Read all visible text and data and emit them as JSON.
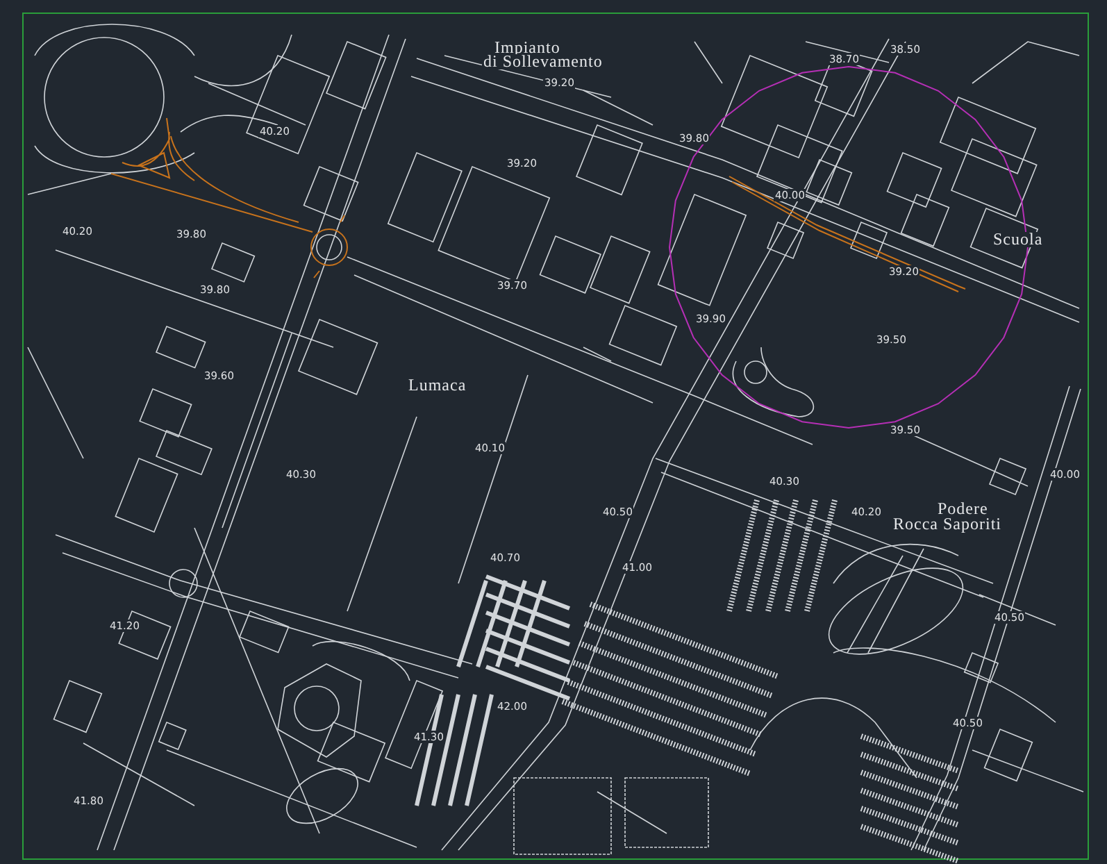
{
  "map": {
    "place_names": [
      {
        "lines": [
          "Impianto",
          "di Sollevamento"
        ]
      },
      {
        "lines": [
          "Lumaca"
        ]
      },
      {
        "lines": [
          "Scuola"
        ]
      },
      {
        "lines": [
          "Podere",
          "Rocca Saporiti"
        ]
      }
    ],
    "spot_heights": [
      "40.20",
      "40.20",
      "39.80",
      "39.80",
      "39.60",
      "39.20",
      "39.20",
      "39.70",
      "39.80",
      "38.70",
      "38.50",
      "40.00",
      "39.20",
      "39.90",
      "39.50",
      "39.50",
      "40.10",
      "40.30",
      "40.50",
      "40.70",
      "41.00",
      "41.20",
      "42.00",
      "41.30",
      "41.80",
      "40.30",
      "40.20",
      "40.00",
      "40.50",
      "40.50"
    ]
  }
}
